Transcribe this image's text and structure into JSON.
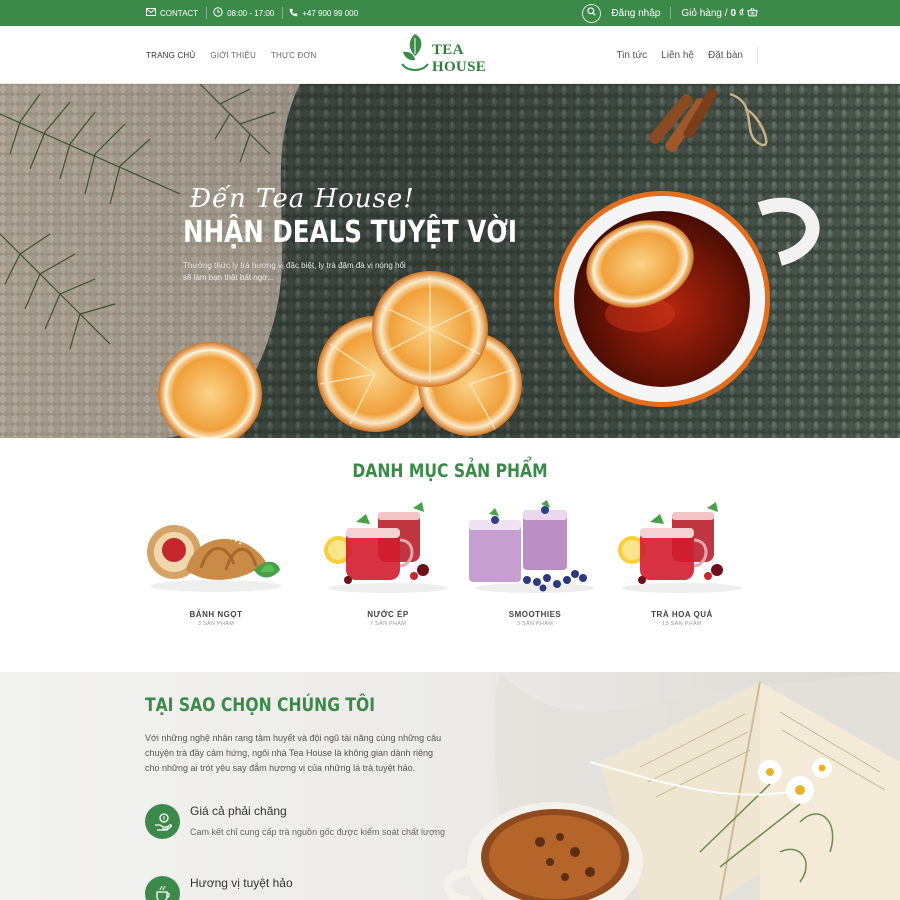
{
  "topbar": {
    "contact_label": "CONTACT",
    "hours": "08:00 - 17:00",
    "phone": "+47 900 99 000",
    "login": "Đăng nhập",
    "cart_label": "Giỏ hàng /",
    "cart_total": "0 ₫"
  },
  "header": {
    "nav_left": [
      "TRANG CHỦ",
      "GIỚI THIỆU",
      "THỰC ĐƠN"
    ],
    "logo_text": "TEA HOUSE",
    "nav_right": [
      "Tin tức",
      "Liên hệ",
      "Đặt bàn"
    ]
  },
  "hero": {
    "script": "Đến Tea House!",
    "title": "NHẬN DEALS TUYỆT VỜI",
    "description": "Thưởng thức ly trà hương vị đặc biệt, ly trà đậm đà vị nóng hổi sẽ làm bạn thật bất ngờ..."
  },
  "categories": {
    "heading": "DANH MỤC SẢN PHẨM",
    "items": [
      {
        "name": "BÁNH NGỌT",
        "count": "3 SẢN PHẨM"
      },
      {
        "name": "NƯỚC ÉP",
        "count": "7 SẢN PHẨM"
      },
      {
        "name": "SMOOTHIES",
        "count": "3 SẢN PHẨM"
      },
      {
        "name": "TRÀ HOA QUẢ",
        "count": "13 SẢN PHẨM"
      }
    ]
  },
  "why": {
    "heading": "TẠI SAO CHỌN CHÚNG TÔI",
    "text": "Với những nghệ nhân rang tâm huyết và đội ngũ tài năng cùng những câu chuyện trà đầy cảm hứng, ngôi nhà Tea House là không gian dành riêng cho những ai trót yêu say đắm hương vị của những lá trà tuyệt hảo.",
    "features": [
      {
        "title": "Giá cả phải chăng",
        "desc": "Cam kết chỉ cung cấp trà nguồn gốc được kiểm soát chất lượng",
        "icon": "money-hand-icon"
      },
      {
        "title": "Hương vị tuyệt hảo",
        "desc": "",
        "icon": "coffee-cup-icon"
      }
    ]
  },
  "colors": {
    "brand_green": "#3b8a4a"
  }
}
